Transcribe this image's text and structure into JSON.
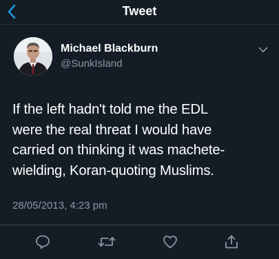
{
  "nav": {
    "title": "Tweet",
    "back_icon": "chevron-left-icon"
  },
  "tweet": {
    "author_name": "Michael Blackburn",
    "author_handle": "@SunkIsland",
    "text": "If the left hadn't told me the EDL\nwere the real threat I would have\ncarried on thinking it was machete-\nwielding, Koran-quoting Muslims.",
    "timestamp": "28/05/2013, 4:23 pm"
  },
  "actions": [
    {
      "name": "reply",
      "icon": "reply-bubble-icon"
    },
    {
      "name": "retweet",
      "icon": "retweet-icon"
    },
    {
      "name": "like",
      "icon": "heart-icon"
    },
    {
      "name": "share",
      "icon": "share-icon"
    }
  ],
  "colors": {
    "background": "#141d26",
    "accent": "#1da1f2",
    "secondary_text": "#8899a6",
    "primary_text": "#ffffff"
  }
}
